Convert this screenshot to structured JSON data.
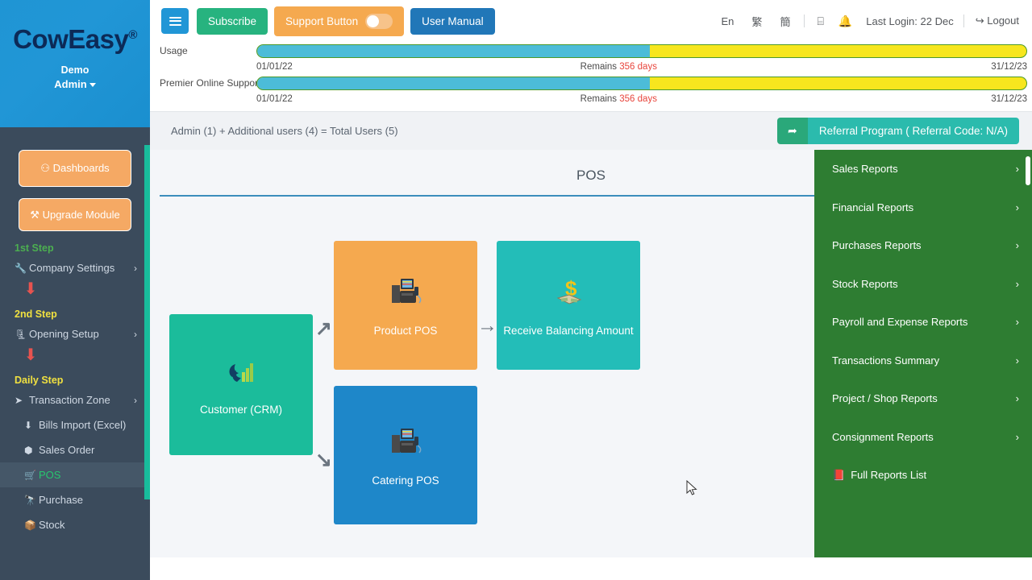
{
  "brand": {
    "name": "CowEasy",
    "registered": "®",
    "demo_label": "Demo",
    "admin_label": "Admin"
  },
  "sidebar": {
    "buttons": [
      {
        "label": "Dashboards",
        "icon": "dashboard-icon",
        "glyph": "⚇"
      },
      {
        "label": "Upgrade Module",
        "icon": "upgrade-icon",
        "glyph": "⚒"
      }
    ],
    "steps": [
      {
        "step_label": "1st Step",
        "color": "#4caf50"
      },
      {
        "step_label": "2nd Step",
        "color": "#f0e040"
      },
      {
        "step_label": "Daily Step",
        "color": "#f0e040"
      }
    ],
    "items": [
      {
        "label": "Company Settings",
        "glyph": "🔧",
        "chevron": "›",
        "name": "company-settings"
      },
      {
        "label": "Opening Setup",
        "glyph": "🗜",
        "chevron": "›",
        "name": "opening-setup"
      },
      {
        "label": "Transaction Zone",
        "glyph": "➤",
        "chevron": "›",
        "name": "transaction-zone"
      },
      {
        "label": "Bills Import (Excel)",
        "glyph": "⬇",
        "chevron": "",
        "name": "bills-import"
      },
      {
        "label": "Sales Order",
        "glyph": "⬢",
        "chevron": "",
        "name": "sales-order"
      },
      {
        "label": "POS",
        "glyph": "🛒",
        "chevron": "",
        "name": "pos"
      },
      {
        "label": "Purchase",
        "glyph": "🔭",
        "chevron": "",
        "name": "purchase"
      },
      {
        "label": "Stock",
        "glyph": "📦",
        "chevron": "",
        "name": "stock"
      }
    ],
    "active_item": "POS",
    "arrow_glyph": "⬇"
  },
  "topbar": {
    "menu_toggle": "hamburger-icon",
    "subscribe_label": "Subscribe",
    "support_label": "Support Button",
    "support_toggle_on": false,
    "user_manual_label": "User Manual",
    "languages": [
      {
        "label": "En",
        "name": "lang-en"
      },
      {
        "label": "繁",
        "name": "lang-traditional"
      },
      {
        "label": "簡",
        "name": "lang-simplified"
      }
    ],
    "screen_icon": "⌸",
    "bell_icon": "🔔",
    "last_login": "Last Login: 22 Dec",
    "logout_label": "Logout",
    "logout_icon": "↪"
  },
  "usage": {
    "rows": [
      {
        "label": "Usage",
        "percent": 51,
        "start_date": "01/01/22",
        "remains_prefix": "Remains",
        "remains_value": "356 days",
        "end_date": "31/12/23"
      },
      {
        "label": "Premier Online Support",
        "percent": 51,
        "start_date": "01/01/22",
        "remains_prefix": "Remains",
        "remains_value": "356 days",
        "end_date": "31/12/23"
      }
    ]
  },
  "users": {
    "summary": "Admin (1) + Additional users (4) = Total Users (5)",
    "share_icon": "➦",
    "referral_label": "Referral Program ( Referral Code: N/A)"
  },
  "content": {
    "page_title": "POS",
    "cards": [
      {
        "label": "Customer (CRM)",
        "color": "#1bbc9b",
        "icon": "crm-chart-icon",
        "glyph": "📊",
        "name": "card-customer-crm"
      },
      {
        "label": "Product POS",
        "color": "#f5a94f",
        "icon": "pos-terminal-icon",
        "glyph": "🖥",
        "name": "card-product-pos"
      },
      {
        "label": "Receive Balancing Amount",
        "color": "#23bdb8",
        "icon": "money-icon",
        "glyph": "💰",
        "name": "card-receive-balancing-amount"
      },
      {
        "label": "Catering POS",
        "color": "#1e87c9",
        "icon": "pos-terminal-icon",
        "glyph": "🖥",
        "name": "card-catering-pos"
      }
    ],
    "arrows": {
      "north_east": "↗",
      "east": "→",
      "south_east": "↘"
    }
  },
  "reports_menu": {
    "items": [
      {
        "label": "Sales Reports",
        "chevron": "›",
        "name": "sales-reports"
      },
      {
        "label": "Financial Reports",
        "chevron": "›",
        "name": "financial-reports"
      },
      {
        "label": "Purchases Reports",
        "chevron": "›",
        "name": "purchases-reports"
      },
      {
        "label": "Stock Reports",
        "chevron": "›",
        "name": "stock-reports"
      },
      {
        "label": "Payroll and Expense Reports",
        "chevron": "›",
        "name": "payroll-expense-reports"
      },
      {
        "label": "Transactions Summary",
        "chevron": "›",
        "name": "transactions-summary"
      },
      {
        "label": "Project / Shop Reports",
        "chevron": "›",
        "name": "project-shop-reports"
      },
      {
        "label": "Consignment Reports",
        "chevron": "›",
        "name": "consignment-reports"
      },
      {
        "label": "Full Reports List",
        "chevron": "",
        "glyph": "📕",
        "name": "full-reports-list"
      }
    ]
  },
  "colors": {
    "brand_blue": "#1f95d4",
    "sidebar_dark": "#3b4b5c",
    "accent_green": "#28c76f",
    "orange": "#f5a94f",
    "teal": "#1bbc9b",
    "reports_green": "#2e7d32",
    "yellow_bar": "#f7e61e",
    "blue_bar": "#4cbcd8",
    "red_text": "#e8453c"
  }
}
